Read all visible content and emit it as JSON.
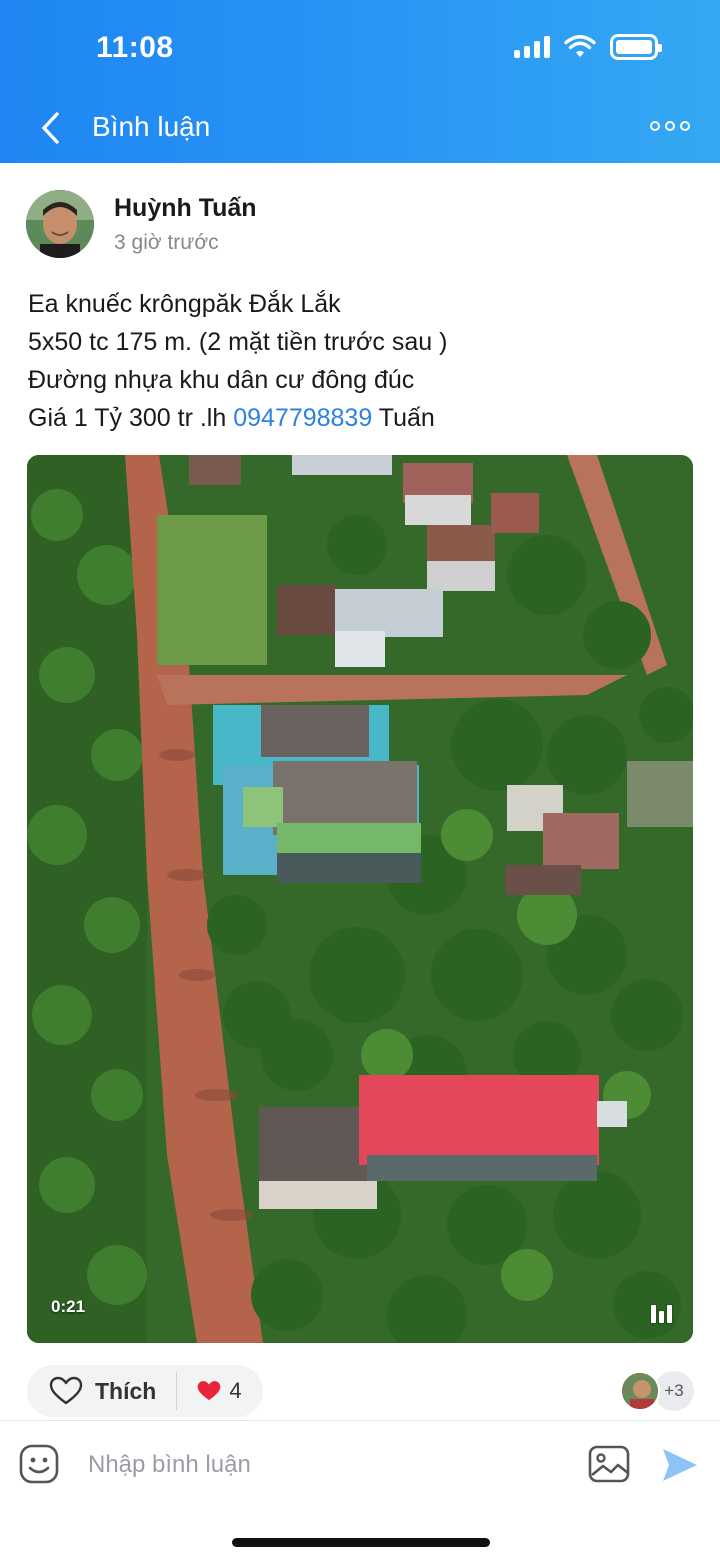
{
  "status_bar": {
    "time": "11:08"
  },
  "header": {
    "title": "Bình luận"
  },
  "post": {
    "author": "Huỳnh Tuấn",
    "time": "3 giờ trước",
    "lines": [
      "Ea knuếc krôngpăk Đắk Lắk",
      "5x50 tc 175 m. (2 mặt tiền trước sau )",
      "Đường nhựa khu dân cư đông đúc"
    ],
    "price_prefix": "Giá 1 Tỷ 300 tr .lh ",
    "phone": "0947798839",
    "price_suffix": " Tuấn",
    "video_duration": "0:21"
  },
  "actions": {
    "like_label": "Thích",
    "reaction_count": "4",
    "more_reactors": "+3"
  },
  "comment": {
    "placeholder": "Nhập bình luận"
  },
  "colors": {
    "header_start": "#1f86f3",
    "header_end": "#34a8f3",
    "link": "#2b82e0",
    "send": "#8ec3f5",
    "heart": "#e8233a"
  },
  "icons": [
    "back-arrow-icon",
    "more-icon",
    "signal-icon",
    "wifi-icon",
    "battery-icon",
    "heart-outline-icon",
    "heart-icon",
    "emoji-icon",
    "image-icon",
    "send-icon",
    "video-bars-icon"
  ]
}
